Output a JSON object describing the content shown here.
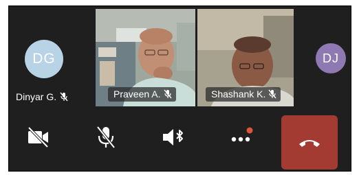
{
  "participants": [
    {
      "initials": "DG",
      "name": "Dinyar G.",
      "avatar_color": "#b9d3e6"
    },
    {
      "name": "Praveen A."
    },
    {
      "name": "Shashank K."
    },
    {
      "initials": "DJ",
      "avatar_color": "#8e79b2"
    }
  ],
  "controls": {
    "camera": "video-off-icon",
    "mic": "mic-off-icon",
    "audio": "speaker-bluetooth-icon",
    "more": "more-dots-icon",
    "hangup": "hangup-phone-icon"
  },
  "colors": {
    "background": "#1f1f1f",
    "hangup": "#a43b32",
    "notification_dot": "#e0533b"
  }
}
